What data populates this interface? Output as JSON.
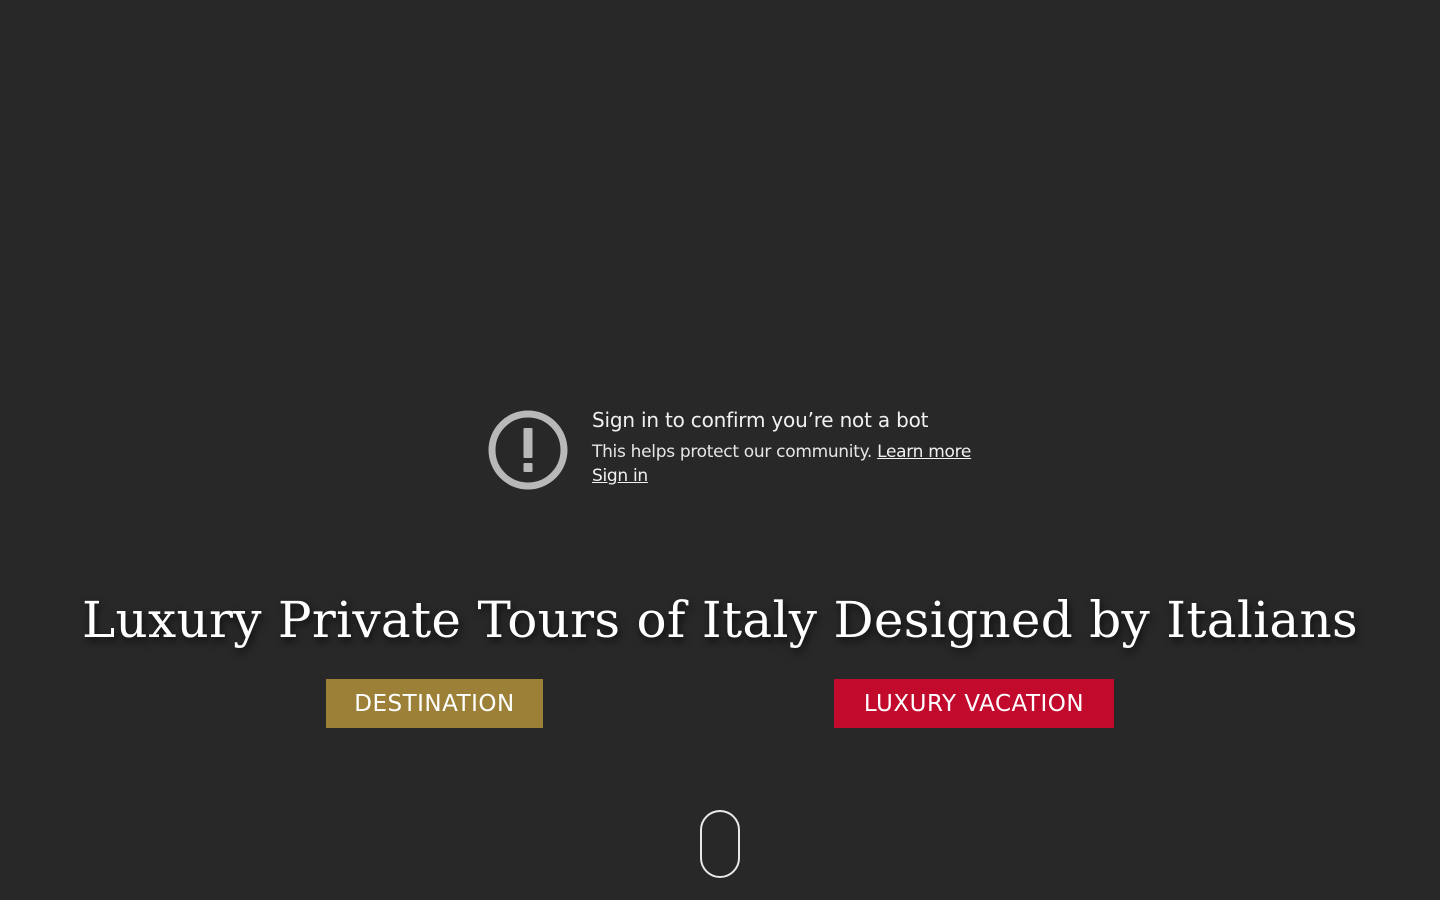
{
  "notice": {
    "title": "Sign in to confirm you’re not a bot",
    "body": "This helps protect our community.",
    "learn_more": "Learn more",
    "sign_in": "Sign in",
    "icon": "alert-circle-icon"
  },
  "hero": {
    "headline": "Luxury Private Tours of Italy Designed by Italians"
  },
  "buttons": {
    "destination": "DESTINATION",
    "luxury_vacation": "LUXURY VACATION"
  },
  "colors": {
    "background": "#282828",
    "destination_button": "#9c8038",
    "luxury_button": "#c20a2c",
    "icon_gray": "#b8b8b8"
  },
  "scroll_indicator": {
    "icon": "scroll-mouse-icon"
  }
}
